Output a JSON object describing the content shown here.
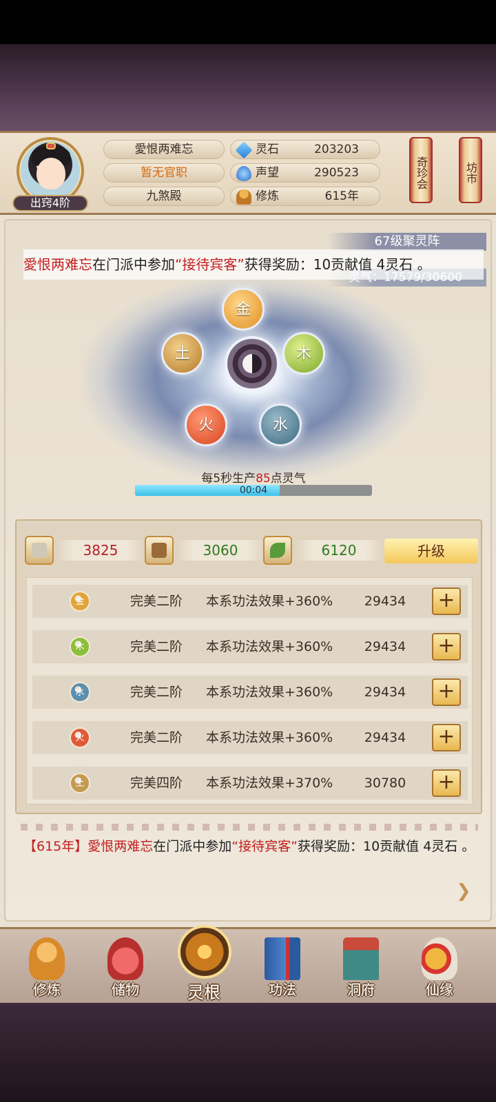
{
  "player": {
    "rank": "出窍4阶",
    "name": "愛恨两难忘",
    "office": "暂无官职",
    "hall": "九煞殿"
  },
  "resources": [
    {
      "label": "灵石",
      "value": "203203",
      "icon": "spirit-stone-icon"
    },
    {
      "label": "声望",
      "value": "290523",
      "icon": "prestige-icon"
    },
    {
      "label": "修炼",
      "value": "615年",
      "icon": "cultivation-icon"
    }
  ],
  "side_buttons": {
    "treasure": "奇珍会",
    "market": "坊市"
  },
  "formation": {
    "title": "67级聚灵阵",
    "qi": "灵气：17579/30600",
    "elements": [
      "金",
      "木",
      "水",
      "火",
      "土"
    ],
    "produce_prefix": "每5秒生产",
    "produce_amount": "85",
    "produce_suffix": "点灵气",
    "progress_percent": 61,
    "progress_text": "00:04"
  },
  "ticker": {
    "name": "愛恨两难忘",
    "text1": "在门派中参加",
    "event": "“接待宾客”",
    "text2": "获得奖励：10贡献值 4灵石 。"
  },
  "costs": [
    {
      "value": "3825",
      "icon": "book-icon"
    },
    {
      "value": "3060",
      "icon": "scroll-stack-icon"
    },
    {
      "value": "6120",
      "icon": "herb-icon"
    }
  ],
  "upgrade_label": "升级",
  "roots": [
    {
      "element": "金",
      "stage": "完美二阶",
      "effect": "本系功法效果+360%",
      "power": "29434",
      "color": "#e2a33a"
    },
    {
      "element": "木",
      "stage": "完美二阶",
      "effect": "本系功法效果+360%",
      "power": "29434",
      "color": "#8cbf3a"
    },
    {
      "element": "水",
      "stage": "完美二阶",
      "effect": "本系功法效果+360%",
      "power": "29434",
      "color": "#5c8fb0"
    },
    {
      "element": "火",
      "stage": "完美二阶",
      "effect": "本系功法效果+360%",
      "power": "29434",
      "color": "#e05a3a"
    },
    {
      "element": "土",
      "stage": "完美四阶",
      "effect": "本系功法效果+370%",
      "power": "30780",
      "color": "#c49a52"
    }
  ],
  "plus_label": "+",
  "log": {
    "year": "【615年】",
    "name": "愛恨两难忘",
    "text1": "在门派中参加",
    "event": "“接待宾客”",
    "text2": "获得奖励：10贡献值 4灵石 。"
  },
  "nav": [
    {
      "label": "修炼"
    },
    {
      "label": "储物"
    },
    {
      "label": "灵根"
    },
    {
      "label": "功法"
    },
    {
      "label": "洞府"
    },
    {
      "label": "仙缘"
    }
  ]
}
